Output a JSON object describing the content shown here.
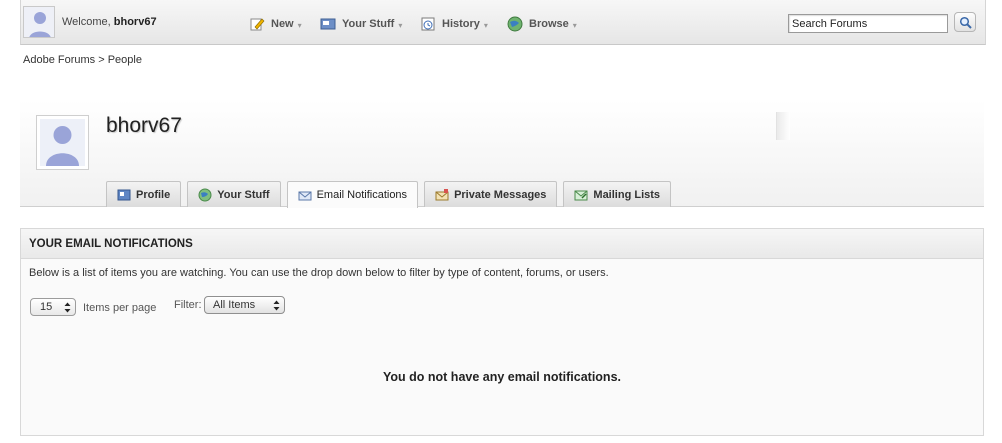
{
  "topbar": {
    "welcome_prefix": "Welcome, ",
    "username": "bhorv67",
    "nav": [
      {
        "label": "New",
        "icon": "pencil-icon"
      },
      {
        "label": "Your Stuff",
        "icon": "inbox-icon"
      },
      {
        "label": "History",
        "icon": "history-icon"
      },
      {
        "label": "Browse",
        "icon": "globe-icon"
      }
    ],
    "search_value": "Search Forums",
    "search_icon": "magnifier-icon"
  },
  "breadcrumb": {
    "root": "Adobe Forums",
    "separator": " > ",
    "current": "People"
  },
  "profile": {
    "username": "bhorv67",
    "tabs": [
      {
        "label": "Profile",
        "icon": "profile-card-icon",
        "active": false
      },
      {
        "label": "Your Stuff",
        "icon": "globe-icon",
        "active": false
      },
      {
        "label": "Email Notifications",
        "icon": "envelope-icon",
        "active": true
      },
      {
        "label": "Private Messages",
        "icon": "private-message-icon",
        "active": false
      },
      {
        "label": "Mailing Lists",
        "icon": "mailing-list-icon",
        "active": false
      }
    ]
  },
  "panel": {
    "title": "YOUR EMAIL NOTIFICATIONS",
    "description": "Below is a list of items you are watching. You can use the drop down below to filter by type of content, forums, or users.",
    "per_page_value": "15",
    "per_page_label": "Items per page",
    "filter_label": "Filter:",
    "filter_value": "All Items",
    "empty_message": "You do not have any email notifications."
  },
  "colors": {
    "topbar_bg": "#ececec",
    "panel_bg": "#fafafa",
    "border": "#d8d8d8"
  }
}
